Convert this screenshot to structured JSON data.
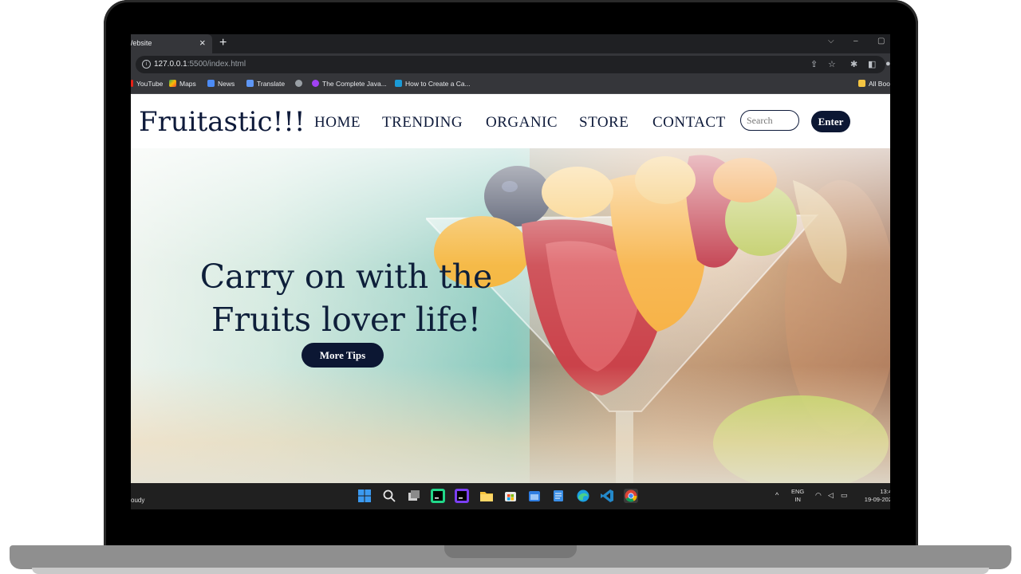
{
  "browser": {
    "tab_title": "Website",
    "tab_close": "×",
    "new_tab": "+",
    "url_host": "127.0.0.1",
    "url_path": ":5500/index.html",
    "bookmarks": [
      "YouTube",
      "Maps",
      "News",
      "Translate",
      "The Complete Java...",
      "How to Create a Ca..."
    ],
    "all_bookmarks": "All Boo",
    "window_controls": [
      "⌵",
      "–",
      "▢"
    ]
  },
  "site": {
    "logo": "Fruitastic!!!",
    "nav": [
      "HOME",
      "TRENDING",
      "ORGANIC",
      "STORE",
      "CONTACT"
    ],
    "search_placeholder": "Search",
    "enter_label": "Enter",
    "hero_line1": "Carry on with the",
    "hero_line2": "Fruits lover life!",
    "hero_button": "More Tips"
  },
  "taskbar": {
    "weather": "oudy",
    "lang_top": "ENG",
    "lang_bottom": "IN",
    "time": "13:4",
    "date": "19-09-202"
  },
  "colors": {
    "brand_navy": "#0e1a3a",
    "button_navy": "#0c1733",
    "chrome_dark": "#202124",
    "chrome_mid": "#35363a"
  }
}
